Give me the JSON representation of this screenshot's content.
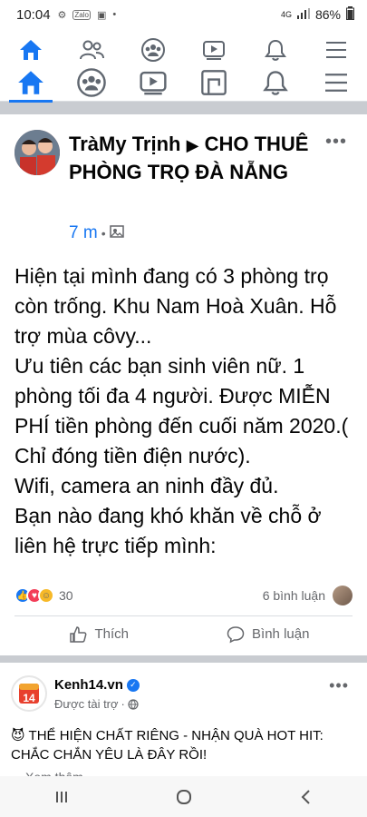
{
  "status_bar": {
    "time": "10:04",
    "battery": "86%",
    "network": "4G"
  },
  "post": {
    "author": "TràMy Trịnh",
    "arrow": "▶",
    "group": "CHO THUÊ PHÒNG TRỌ ĐÀ NẴNG",
    "time": "7 m",
    "separator": "•",
    "more": "•••",
    "body_lines": [
      "Hiện tại mình đang có 3 phòng trọ còn trống. Khu Nam Hoà Xuân. Hỗ trợ mùa côvy...",
      "Ưu tiên các bạn sinh viên nữ. 1 phòng tối đa 4 người. Được MIỄN PHÍ tiền phòng đến cuối năm 2020.( Chỉ đóng tiền điện nước).",
      "Wifi, camera an ninh đầy đủ.",
      "Bạn nào đang khó khăn về chỗ ở liên hệ trực tiếp mình:"
    ],
    "reactions_count": "30",
    "comments_count": "6 bình luận",
    "like_label": "Thích",
    "comment_label": "Bình luận"
  },
  "ad": {
    "name": "Kenh14.vn",
    "logo_text": "14",
    "sponsored": "Được tài trợ",
    "separator": "·",
    "more": "•••",
    "text": "THỂ HIỆN CHẤT RIÊNG - NHẬN QUÀ HOT HIT: CHẮC CHẮN YÊU LÀ ĐÂY RỒI!",
    "see_more": "Xem thêm"
  },
  "colors": {
    "accent": "#1877f2",
    "background": "#c9ccd1"
  },
  "icons": [
    "home-icon",
    "friends-icon",
    "groups-icon",
    "watch-icon",
    "notifications-icon",
    "menu-icon",
    "marketplace-icon"
  ]
}
